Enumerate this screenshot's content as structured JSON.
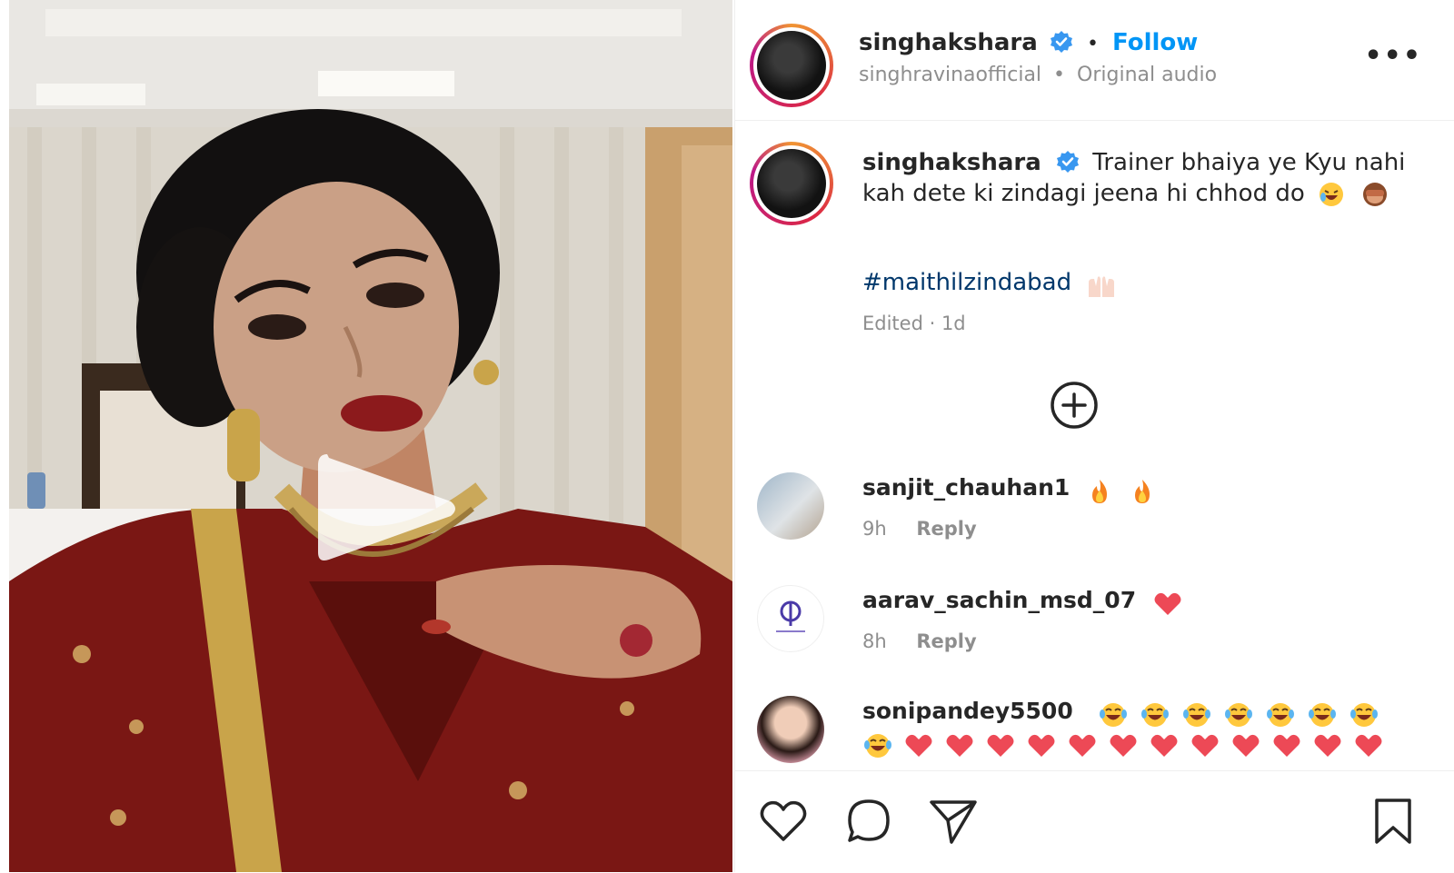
{
  "post": {
    "username": "singhakshara",
    "follow_label": "Follow",
    "audio_owner": "singhravinaofficial",
    "audio_label": "Original audio",
    "separator": "•"
  },
  "caption": {
    "username": "singhakshara",
    "text": "Trainer bhaiya ye Kyu nahi kah dete ki zindagi jeena hi chhod do",
    "emojis": [
      "rolling-laughing-emoji",
      "see-no-evil-monkey-emoji"
    ],
    "hashtag": "#maithilzindabad",
    "hashtag_emoji": "raising-hands-emoji",
    "edited": "Edited · 1d"
  },
  "comments": [
    {
      "username": "sanjit_chauhan1",
      "emojis": [
        "fire-emoji",
        "fire-emoji"
      ],
      "time": "9h",
      "reply": "Reply"
    },
    {
      "username": "aarav_sachin_msd_07",
      "emojis": [
        "red-heart-emoji"
      ],
      "time": "8h",
      "reply": "Reply"
    },
    {
      "username": "sonipandey5500",
      "emojis": [
        "tears-of-joy-emoji x8",
        "red-heart-emoji x12"
      ]
    }
  ],
  "icons": {
    "verified": "verified-badge-icon",
    "more": "more-options-icon",
    "play": "play-icon",
    "load_more": "plus-circle-icon",
    "like": "heart-icon",
    "comment": "comment-icon",
    "share": "share-icon",
    "save": "bookmark-icon"
  },
  "colors": {
    "accent": "#0095f6",
    "verified": "#3897f0",
    "text": "#262626",
    "muted": "#8e8e8e",
    "hashtag": "#00376b",
    "heart": "#ed4956"
  }
}
